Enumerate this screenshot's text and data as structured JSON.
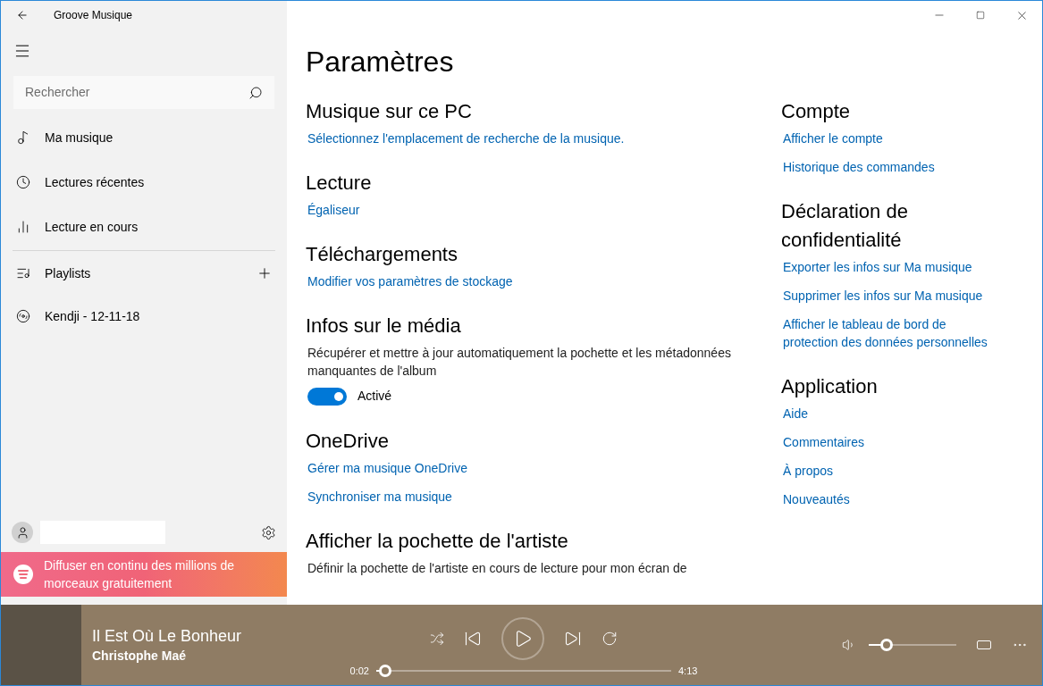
{
  "window": {
    "title": "Groove Musique"
  },
  "sidebar": {
    "search": {
      "placeholder": "Rechercher"
    },
    "items": [
      {
        "kind": "music",
        "label": "Ma musique"
      },
      {
        "kind": "recent",
        "label": "Lectures récentes"
      },
      {
        "kind": "nowplaying",
        "label": "Lecture en cours"
      }
    ],
    "playlists": {
      "label": "Playlists"
    },
    "playlist_items": [
      {
        "label": "Kendji - 12-11-18"
      }
    ],
    "promo": {
      "text": "Diffuser en continu des millions de morceaux gratuitement"
    }
  },
  "settings": {
    "title": "Paramètres",
    "left_sections": [
      {
        "heading": "Musique sur ce PC",
        "links": [
          "Sélectionnez l'emplacement de recherche de la musique."
        ]
      },
      {
        "heading": "Lecture",
        "links": [
          "Égaliseur"
        ]
      },
      {
        "heading": "Téléchargements",
        "links": [
          "Modifier vos paramètres de stockage"
        ]
      },
      {
        "heading": "Infos sur le média",
        "description": "Récupérer et mettre à jour automatiquement la pochette et les métadonnées manquantes de l'album",
        "toggle": {
          "on": true,
          "label": "Activé"
        }
      },
      {
        "heading": "OneDrive",
        "links": [
          "Gérer ma musique OneDrive",
          "Synchroniser ma musique"
        ]
      },
      {
        "heading": "Afficher la pochette de l'artiste",
        "description": "Définir la pochette de l'artiste en cours de lecture pour mon écran de"
      }
    ],
    "right_sections": [
      {
        "heading": "Compte",
        "links": [
          "Afficher le compte",
          "Historique des commandes"
        ]
      },
      {
        "heading": "Déclaration de confidentialité",
        "links": [
          "Exporter les infos sur Ma musique",
          "Supprimer les infos sur Ma musique",
          "Afficher le tableau de bord de protection des données personnelles"
        ]
      },
      {
        "heading": "Application",
        "links": [
          "Aide",
          "Commentaires",
          "À propos",
          "Nouveautés"
        ]
      }
    ]
  },
  "player": {
    "title": "Il Est Où Le Bonheur",
    "artist": "Christophe Maé",
    "elapsed": "0:02",
    "duration": "4:13",
    "progress": {
      "level": 0.03
    },
    "volume": {
      "level": 0.2
    }
  }
}
